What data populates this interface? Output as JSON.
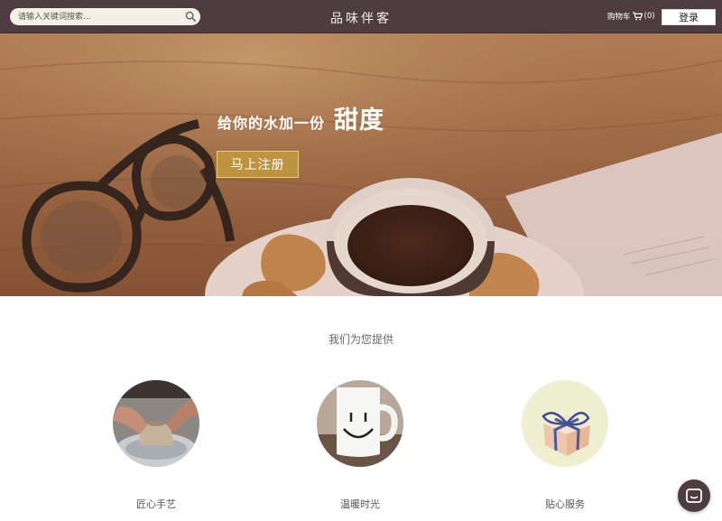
{
  "header": {
    "search_placeholder": "请输入关键词搜索...",
    "brand": "品味伴客",
    "cart_label": "购物车",
    "cart_count": "(0)",
    "login_label": "登录"
  },
  "hero": {
    "title_prefix": "给你的水加一份",
    "title_highlight": "甜度",
    "signup_label": "马上注册"
  },
  "services": {
    "title": "我们为您提供",
    "items": [
      {
        "label": "匠心手艺",
        "icon": "pottery-image"
      },
      {
        "label": "温暖时光",
        "icon": "smiley-mug-image"
      },
      {
        "label": "贴心服务",
        "icon": "gift-box-image"
      }
    ]
  },
  "colors": {
    "header_bg": "#4e3d40",
    "accent": "#c9a03c"
  }
}
